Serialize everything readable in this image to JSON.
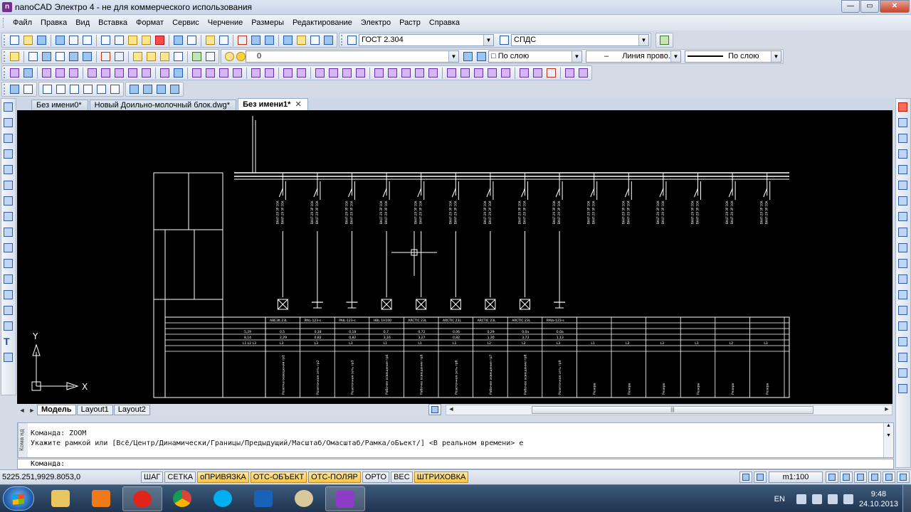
{
  "window": {
    "title": "nanoCAD Электро 4 - не для коммерческого использования",
    "minimize": "—",
    "maximize": "▭",
    "close": "✕"
  },
  "menu": [
    "Файл",
    "Правка",
    "Вид",
    "Вставка",
    "Формат",
    "Сервис",
    "Черчение",
    "Размеры",
    "Редактирование",
    "Электро",
    "Растр",
    "Справка"
  ],
  "toolbar": {
    "text_style": "ГОСТ 2.304",
    "dim_style": "СПДС",
    "layer": "0",
    "color": "□ По слою",
    "linetype_symbol": "–",
    "linetype": "Линия прово...",
    "lineweight": "По слою"
  },
  "doc_tabs": [
    {
      "label": "Без имени0*",
      "active": false
    },
    {
      "label": "Новый Доильно-молочный блок.dwg*",
      "active": false
    },
    {
      "label": "Без имени1*",
      "active": true
    }
  ],
  "layout_tabs": [
    {
      "label": "Модель",
      "active": true
    },
    {
      "label": "Layout1",
      "active": false
    },
    {
      "label": "Layout2",
      "active": false
    }
  ],
  "drawing": {
    "ucs_x": "X",
    "ucs_y": "Y",
    "breaker_label": "ВА47-29 3Р 10А",
    "header_labels": [
      "ABE3K 23L",
      "PAIL-123-s",
      "PAIL-123-s",
      "HBL 1H100",
      "ARCTIC 23L",
      "ARCTIC 23L",
      "ARCTIC 23L",
      "ARCTIC 23L",
      "PAVo-123-s"
    ],
    "power_values": [
      "5,29",
      "0,5",
      "0,18",
      "0,18",
      "0,7",
      "0,72",
      "0,06",
      "0,29",
      "0,0a",
      "0,0a"
    ],
    "current_values": [
      "8,14",
      "2,29",
      "0,82",
      "0,82",
      "3,16",
      "3,27",
      "0,82",
      "1,30",
      "3,73",
      "1,13"
    ],
    "phase_values": [
      "L1 L2 L3",
      "L3",
      "L3",
      "L3",
      "L1",
      "L1",
      "L1",
      "L2",
      "L2",
      "L3",
      "L1",
      "L2",
      "L3",
      "L3",
      "L2",
      "L3"
    ],
    "consumer_labels": [
      "Розетка освещения гр1",
      "Розеточная сеть гр2",
      "Розеточная сеть гр3",
      "Рабочее освещение гр4",
      "Рабочее освещение гр5",
      "Розеточная сеть гр6",
      "Рабочее освещение гр7",
      "Рабочее освещение гр8",
      "Розеточная сеть гр9",
      "Резерв",
      "Резерв",
      "Резерв",
      "Резерв",
      "Резерв",
      "Резерв"
    ]
  },
  "command": {
    "line1": "Команда: ZOOM",
    "line2": "Укажите рамкой или [Всё/Центр/Динамически/Границы/Предыдущий/Масштаб/Омасштаб/Рамка/оБъект/] <В реальном времени> е",
    "prompt": "Команда:",
    "side_label": "Кома нд"
  },
  "status": {
    "coords": "5225.251,9929.8053,0",
    "buttons": [
      {
        "label": "ШАГ",
        "on": false
      },
      {
        "label": "СЕТКА",
        "on": false
      },
      {
        "label": "оПРИВЯЗКА",
        "on": true
      },
      {
        "label": "ОТС-ОБЪЕКТ",
        "on": true
      },
      {
        "label": "ОТС-ПОЛЯР",
        "on": true
      },
      {
        "label": "ОРТО",
        "on": false
      },
      {
        "label": "ВЕС",
        "on": false
      },
      {
        "label": "ШТРИХОВКА",
        "on": true
      }
    ],
    "scale": "m1:100"
  },
  "taskbar": {
    "lang": "EN",
    "time": "9:48",
    "date": "24.10.2013"
  },
  "colors": {
    "canvas": "#000000",
    "drawing_lines": "#ffffff",
    "status_on": "#f6c54d"
  }
}
